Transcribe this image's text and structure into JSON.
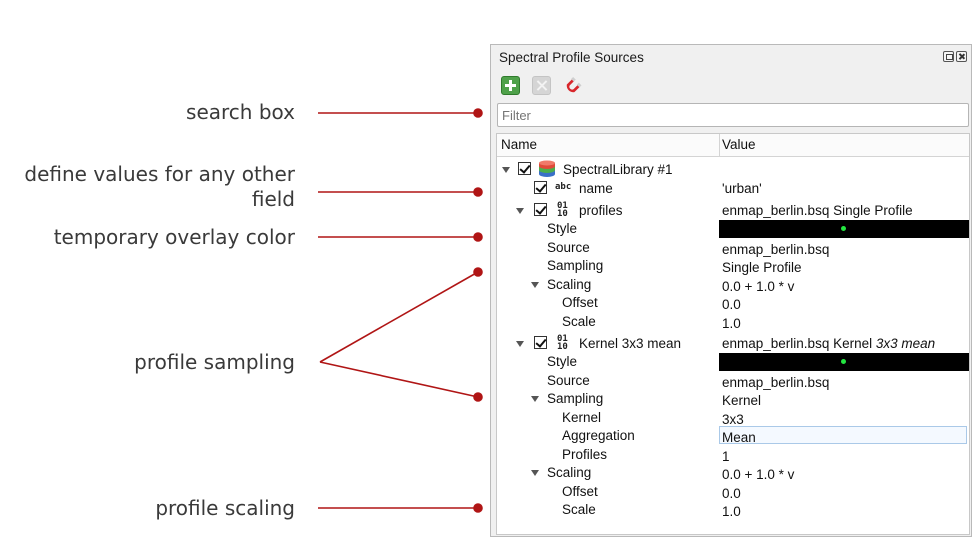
{
  "annotations": [
    {
      "id": "search-box",
      "text": "search box"
    },
    {
      "id": "define-values",
      "line1": "define values for any other",
      "line2": "field"
    },
    {
      "id": "overlay-color",
      "text": "temporary overlay color"
    },
    {
      "id": "profile-sampling",
      "text": "profile sampling"
    },
    {
      "id": "profile-scaling",
      "text": "profile scaling"
    }
  ],
  "panel": {
    "title": "Spectral Profile Sources",
    "toolbar": {
      "add_icon": "add-green-plus-icon",
      "remove_icon": "remove-x-icon",
      "relations_icon": "magnet-icon"
    },
    "filter": {
      "placeholder": "Filter",
      "value": ""
    },
    "columns": {
      "name": "Name",
      "value": "Value"
    },
    "overlay_color": "#23e640",
    "tree": {
      "library": "SpectralLibrary #1",
      "name_field": {
        "label": "name",
        "type_icon": "abc",
        "value": "'urban'"
      },
      "profiles1": {
        "label": "profiles",
        "type_icon_top": "01",
        "type_icon_bottom": "10",
        "value": "enmap_berlin.bsq Single Profile",
        "style": "Style",
        "source_label": "Source",
        "source_value": "enmap_berlin.bsq",
        "sampling_label": "Sampling",
        "sampling_value": "Single Profile",
        "scaling_label": "Scaling",
        "scaling_value": "0.0 + 1.0 * v",
        "offset_label": "Offset",
        "offset_value": "0.0",
        "scale_label": "Scale",
        "scale_value": "1.0"
      },
      "profiles2": {
        "label": "Kernel 3x3 mean",
        "type_icon_top": "01",
        "type_icon_bottom": "10",
        "value_plain": "enmap_berlin.bsq Kernel ",
        "value_italic": "3x3 mean",
        "style": "Style",
        "source_label": "Source",
        "source_value": "enmap_berlin.bsq",
        "sampling_label": "Sampling",
        "sampling_value": "Kernel",
        "kernel_label": "Kernel",
        "kernel_value": "3x3",
        "aggregation_label": "Aggregation",
        "aggregation_value": "Mean",
        "profiles_label": "Profiles",
        "profiles_value": "1",
        "scaling_label": "Scaling",
        "scaling_value": "0.0 + 1.0 * v",
        "offset_label": "Offset",
        "offset_value": "0.0",
        "scale_label": "Scale",
        "scale_value": "1.0"
      }
    }
  }
}
